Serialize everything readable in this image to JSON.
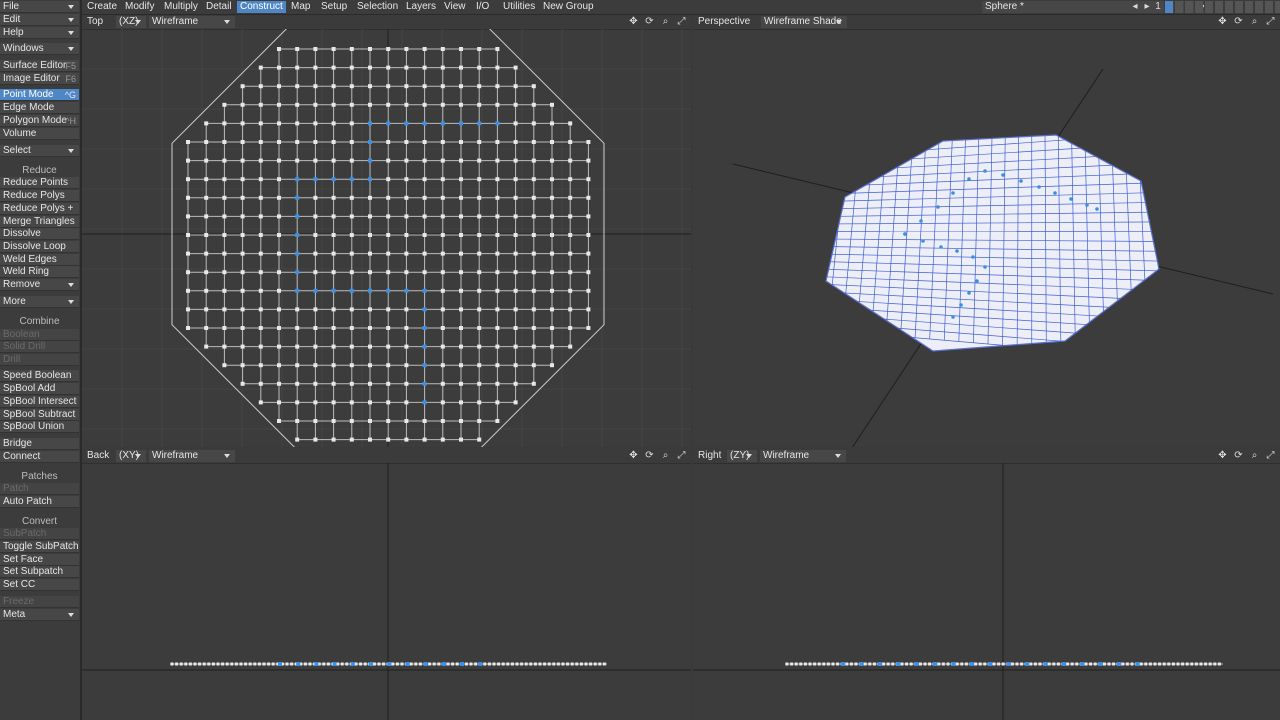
{
  "sidebar": {
    "top_items": [
      {
        "label": "File",
        "dd": true
      },
      {
        "label": "Edit",
        "dd": true
      },
      {
        "label": "Help",
        "dd": true
      }
    ],
    "windows": {
      "label": "Windows"
    },
    "editors": [
      {
        "label": "Surface Editor",
        "hotkey": "F5"
      },
      {
        "label": "Image Editor",
        "hotkey": "F6"
      }
    ],
    "modes": [
      {
        "label": "Point Mode",
        "hotkey": "^G"
      },
      {
        "label": "Edge Mode",
        "hotkey": ""
      },
      {
        "label": "Polygon Mode",
        "hotkey": "^H"
      },
      {
        "label": "Volume",
        "hotkey": ""
      }
    ],
    "select": {
      "label": "Select"
    },
    "reduce_header": "Reduce",
    "reduce_items": [
      "Reduce Points",
      "Reduce Polys",
      "Reduce Polys +",
      "Merge Triangles",
      "Dissolve",
      "Dissolve Loop",
      "Weld Edges",
      "Weld Ring",
      "Remove"
    ],
    "more": {
      "label": "More"
    },
    "combine_header": "Combine",
    "combine_disabled": [
      "Boolean",
      "Solid Drill",
      "Drill"
    ],
    "combine_items": [
      "Speed Boolean",
      "SpBool Add",
      "SpBool Intersect",
      "SpBool Subtract",
      "SpBool Union"
    ],
    "bridge_items": [
      "Bridge",
      "Connect"
    ],
    "patches_header": "Patches",
    "patches_disabled": "Patch",
    "patches_items": [
      "Auto Patch"
    ],
    "convert_header": "Convert",
    "convert_disabled": "SubPatch",
    "convert_items": [
      "Toggle SubPatch",
      "Set Face",
      "Set Subpatch",
      "Set CC"
    ],
    "extra_disabled": "Freeze",
    "meta": {
      "label": "Meta"
    }
  },
  "menu_tabs": [
    "Create",
    "Modify",
    "Multiply",
    "Detail",
    "Construct",
    "Map",
    "Setup",
    "Selection",
    "Layers",
    "View",
    "I/O",
    "Utilities",
    "New Group"
  ],
  "active_tab": "Construct",
  "object_selector": "Sphere *",
  "layer_number": "1",
  "viewports": {
    "top": {
      "view": "Top",
      "axis": "(XZ)",
      "mode": "Wireframe"
    },
    "persp": {
      "view": "Perspective",
      "mode": "Wireframe Shade"
    },
    "back": {
      "view": "Back",
      "axis": "(XY)",
      "mode": "Wireframe"
    },
    "right": {
      "view": "Right",
      "axis": "(ZY)",
      "mode": "Wireframe"
    }
  },
  "icons": [
    "move-view-icon",
    "rotate-view-icon",
    "zoom-view-icon",
    "maximize-view-icon"
  ],
  "colors": {
    "selected_point": "#3a8fe8",
    "point": "#e8e8e8",
    "active_tab": "#4f86c6"
  }
}
